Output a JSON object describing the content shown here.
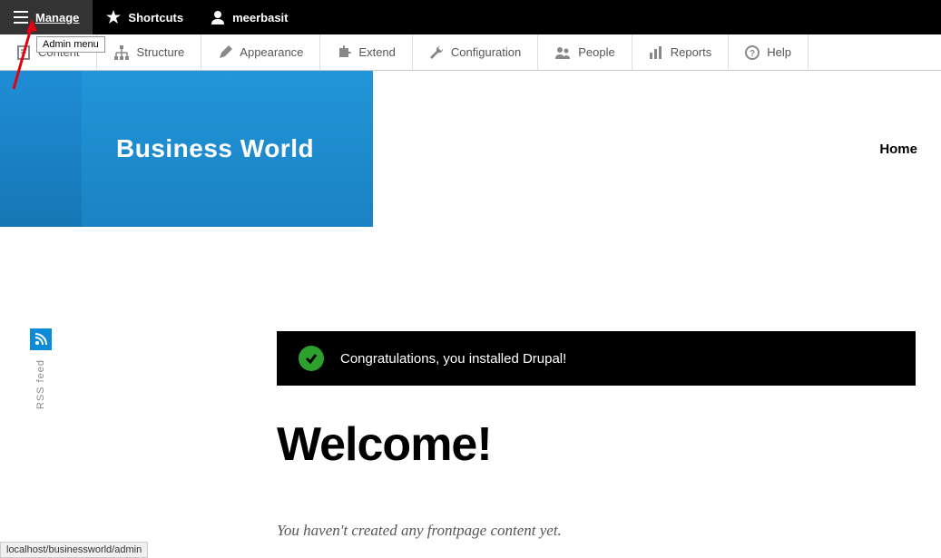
{
  "topbar": {
    "manage": "Manage",
    "shortcuts": "Shortcuts",
    "user": "meerbasit"
  },
  "tooltip": "Admin menu",
  "admin": {
    "content": "Content",
    "structure": "Structure",
    "appearance": "Appearance",
    "extend": "Extend",
    "configuration": "Configuration",
    "people": "People",
    "reports": "Reports",
    "help": "Help"
  },
  "site_name": "Business World",
  "nav_home": "Home",
  "rss_label": "RSS feed",
  "alert_text": "Congratulations, you installed Drupal!",
  "page_title": "Welcome!",
  "subtext": "You haven't created any frontpage content yet.",
  "status_url": "localhost/businessworld/admin"
}
